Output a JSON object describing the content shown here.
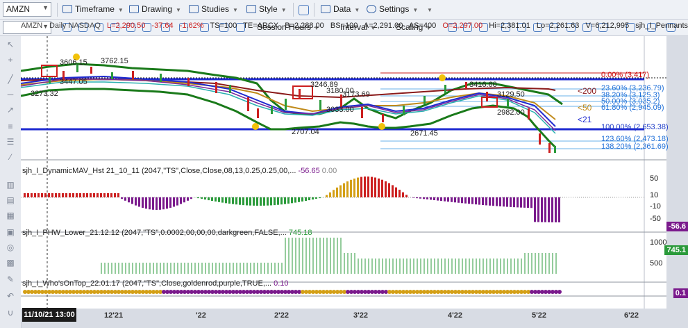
{
  "toolbar": {
    "symbol": "AMZN",
    "menus": {
      "timeframe": "Timeframe",
      "drawing": "Drawing",
      "studies": "Studies",
      "style": "Style",
      "data": "Data",
      "settings": "Settings"
    },
    "session_hours": "Session Hours",
    "interval": "Interval",
    "scaling": "Scaling"
  },
  "quote": {
    "symbol_line": "AMZN - Daily  NASDAQ",
    "last": "L=2,290.50",
    "change": "-37.64",
    "pct": "-1.62%",
    "ts": "TS=100",
    "te": "TE=ARCX",
    "bid": "B=2,288.00",
    "bs": "BS=100",
    "ask": "A=2,291.00",
    "as": "AS=400",
    "open": "O=2,297.00",
    "high": "Hi=2,381.01",
    "low": "Lo=2,261.63",
    "vol": "V=6,212,995",
    "study": "sjh_I_Pennants..."
  },
  "price_labels": {
    "p3606": "3606.15",
    "p3762": "3762.15",
    "p3447": "3447.05",
    "p3273": "3273.32",
    "p3246": "3246.89",
    "p3180": "3180.00",
    "p3173": "3173.69",
    "p3033": "3033.00",
    "p2707": "2707.04",
    "p2671": "2671.45",
    "p3416": "3416.60",
    "p3129": "3129.50",
    "p2982": "2982.00"
  },
  "fib": [
    {
      "label": "0.00% (3,417)",
      "color": "#cc0000"
    },
    {
      "label": "23.60% (3,236.79)",
      "color": "#1e6fd8"
    },
    {
      "label": "38.20% (3,125.3)",
      "color": "#1e6fd8"
    },
    {
      "label": "50.00% (3,035.2)",
      "color": "#1e6fd8"
    },
    {
      "label": "61.80% (2,945.09)",
      "color": "#1e6fd8"
    },
    {
      "label": "100.00% (2,653.38)",
      "color": "#1e3cc8"
    },
    {
      "label": "123.60% (2,473.18)",
      "color": "#1e6fd8"
    },
    {
      "label": "138.20% (2,361.69)",
      "color": "#1e6fd8"
    }
  ],
  "ma_labels": {
    "m200": "<200",
    "m50": "<50",
    "m21": "<21"
  },
  "panes": {
    "mav": {
      "title": "sjh_I_DynamicMAV_Hst 21_10_11 (2047,\"TS\",Close,Close,08,13,0.25,0.25,00,...",
      "v1": "-56.65",
      "v2": "0.00",
      "badge": "-56.6",
      "y": [
        "50",
        "10",
        "-10",
        "-50"
      ]
    },
    "phw": {
      "title": "sjh_I_PHW_Lower_21.12.12 (2047,\"TS\",0.0002,00,00,00,darkgreen,FALSE,...",
      "v1": "745.18",
      "badge": "745.1",
      "y": [
        "1000",
        "500"
      ]
    },
    "who": {
      "title": "sjh_I_Who'sOnTop_22.01.17 (2047,\"TS\",Close,goldenrod,purple,TRUE,...",
      "v1": "0.10",
      "badge": "0.1"
    }
  },
  "x_axis": {
    "cursor": "11/10/21 13:00",
    "ticks": [
      "12'21",
      "'22",
      "2'22",
      "3'22",
      "4'22",
      "5'22",
      "6'22"
    ]
  },
  "colors": {
    "up": "#2a9a3a",
    "down": "#cc1f1f",
    "gold": "#d4a017",
    "purple": "#7a1a8c"
  }
}
